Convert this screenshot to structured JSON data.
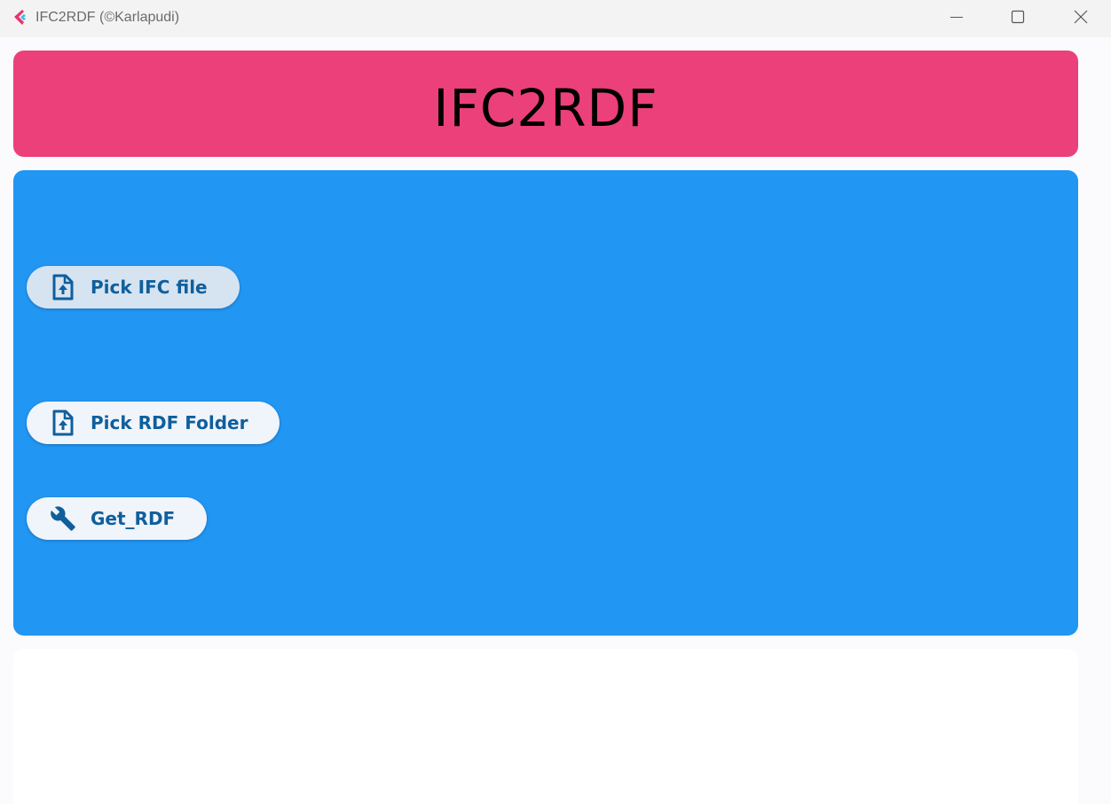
{
  "window": {
    "title": "IFC2RDF (©Karlapudi)",
    "controls": {
      "minimize_icon": "minimize-icon",
      "maximize_icon": "maximize-icon",
      "close_icon": "close-icon"
    }
  },
  "header": {
    "title": "IFC2RDF",
    "background": "#ec407a"
  },
  "main": {
    "background": "#2196f3",
    "buttons": [
      {
        "label": "Pick IFC file",
        "icon": "file-upload-icon"
      },
      {
        "label": "Pick RDF Folder",
        "icon": "file-upload-icon"
      },
      {
        "label": "Get_RDF",
        "icon": "wrench-icon"
      }
    ]
  },
  "colors": {
    "accent_text": "#0f5f9c",
    "button_bg": "#f0f4fb",
    "button_selected_bg": "#d6e3f1"
  }
}
